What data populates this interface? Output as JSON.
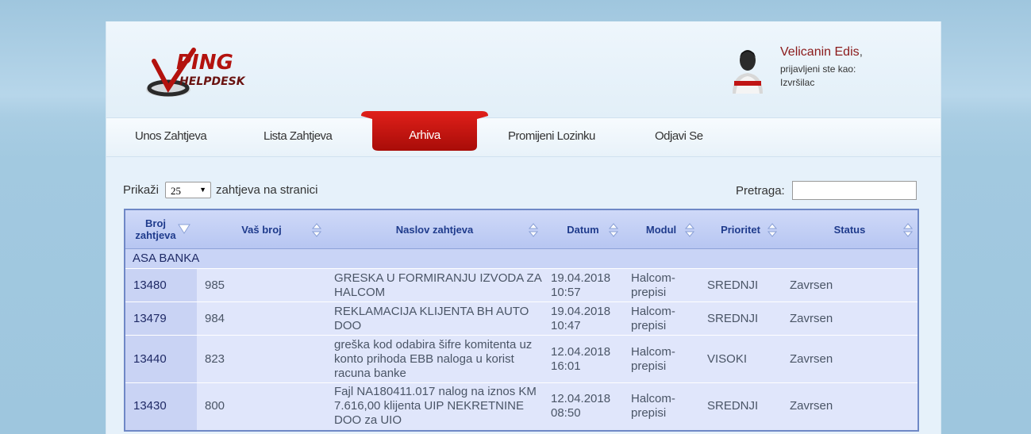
{
  "header": {
    "user_name": "Velicanin Edis",
    "logged_in_label": "prijavljeni ste kao:",
    "role": "Izvršilac"
  },
  "nav": {
    "items": [
      "Unos Zahtjeva",
      "Lista Zahtjeva",
      "Arhiva",
      "Promijeni Lozinku",
      "Odjavi Se"
    ],
    "active": "Arhiva"
  },
  "controls": {
    "show_label": "Prikaži",
    "page_size": "25",
    "show_suffix": "zahtjeva na stranici",
    "search_label": "Pretraga:",
    "search_value": ""
  },
  "table": {
    "columns": [
      "Broj zahtjeva",
      "Vaš broj",
      "Naslov zahtjeva",
      "Datum",
      "Modul",
      "Prioritet",
      "Status"
    ],
    "group": "ASA BANKA",
    "rows": [
      {
        "broj": "13480",
        "vas_broj": "985",
        "naslov": "GRESKA U FORMIRANJU IZVODA ZA HALCOM",
        "datum": "19.04.2018 10:57",
        "modul": "Halcom-prepisi",
        "prioritet": "SREDNJI",
        "status": "Zavrsen"
      },
      {
        "broj": "13479",
        "vas_broj": "984",
        "naslov": "REKLAMACIJA KLIJENTA BH AUTO DOO",
        "datum": "19.04.2018 10:47",
        "modul": "Halcom-prepisi",
        "prioritet": "SREDNJI",
        "status": "Zavrsen"
      },
      {
        "broj": "13440",
        "vas_broj": "823",
        "naslov": "greška kod odabira šifre komitenta uz konto prihoda EBB naloga u korist racuna banke",
        "datum": "12.04.2018 16:01",
        "modul": "Halcom-prepisi",
        "prioritet": "VISOKI",
        "status": "Zavrsen"
      },
      {
        "broj": "13430",
        "vas_broj": "800",
        "naslov": "Fajl NA180411.017 nalog na iznos KM 7.616,00 klijenta UIP NEKRETNINE DOO za UIO",
        "datum": "12.04.2018 08:50",
        "modul": "Halcom-prepisi",
        "prioritet": "SREDNJI",
        "status": "Zavrsen"
      }
    ]
  },
  "colors": {
    "accent": "#c0140d",
    "header_text": "#1f3b8c",
    "user_name": "#8b1a1a"
  }
}
